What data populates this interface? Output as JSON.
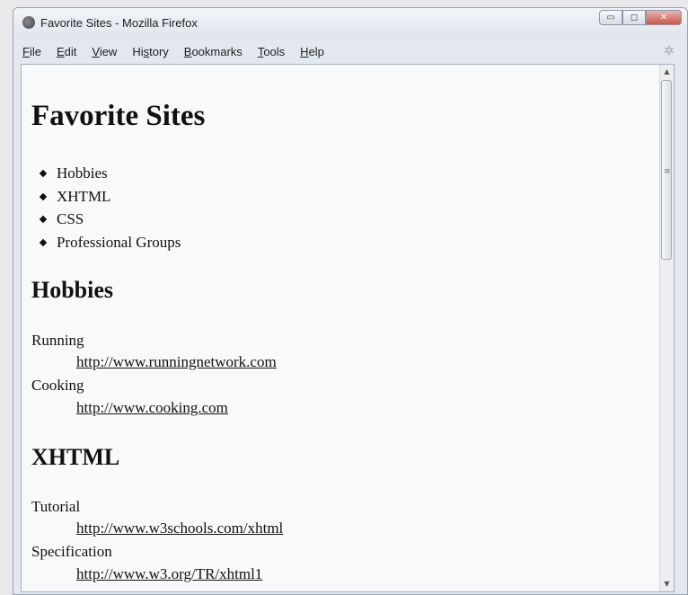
{
  "window": {
    "title": "Favorite Sites - Mozilla Firefox",
    "controls": {
      "minimize": "▭",
      "maximize": "◻",
      "close": "✕"
    }
  },
  "menubar": {
    "items": [
      {
        "underline": "F",
        "rest": "ile"
      },
      {
        "underline": "E",
        "rest": "dit"
      },
      {
        "underline": "V",
        "rest": "iew"
      },
      {
        "before": "Hi",
        "underline": "s",
        "rest": "tory"
      },
      {
        "underline": "B",
        "rest": "ookmarks"
      },
      {
        "underline": "T",
        "rest": "ools"
      },
      {
        "underline": "H",
        "rest": "elp"
      }
    ]
  },
  "page": {
    "title": "Favorite Sites",
    "nav": [
      "Hobbies",
      "XHTML",
      "CSS",
      "Professional Groups"
    ],
    "sections": [
      {
        "heading": "Hobbies",
        "entries": [
          {
            "term": "Running",
            "link": "http://www.runningnetwork.com"
          },
          {
            "term": "Cooking",
            "link": "http://www.cooking.com"
          }
        ]
      },
      {
        "heading": "XHTML",
        "entries": [
          {
            "term": "Tutorial",
            "link": "http://www.w3schools.com/xhtml"
          },
          {
            "term": "Specification",
            "link": "http://www.w3.org/TR/xhtml1"
          }
        ]
      }
    ]
  },
  "icons": {
    "browser": "firefox-icon",
    "throbber": "throbber-icon",
    "scroll_up": "scroll-up-arrow-icon",
    "scroll_down": "scroll-down-arrow-icon",
    "grip": "scrollbar-grip-icon"
  },
  "colors": {
    "titlebar": "#e3e8ef",
    "close_button": "#c9574a",
    "content_bg": "#fafafb",
    "text": "#111111"
  }
}
